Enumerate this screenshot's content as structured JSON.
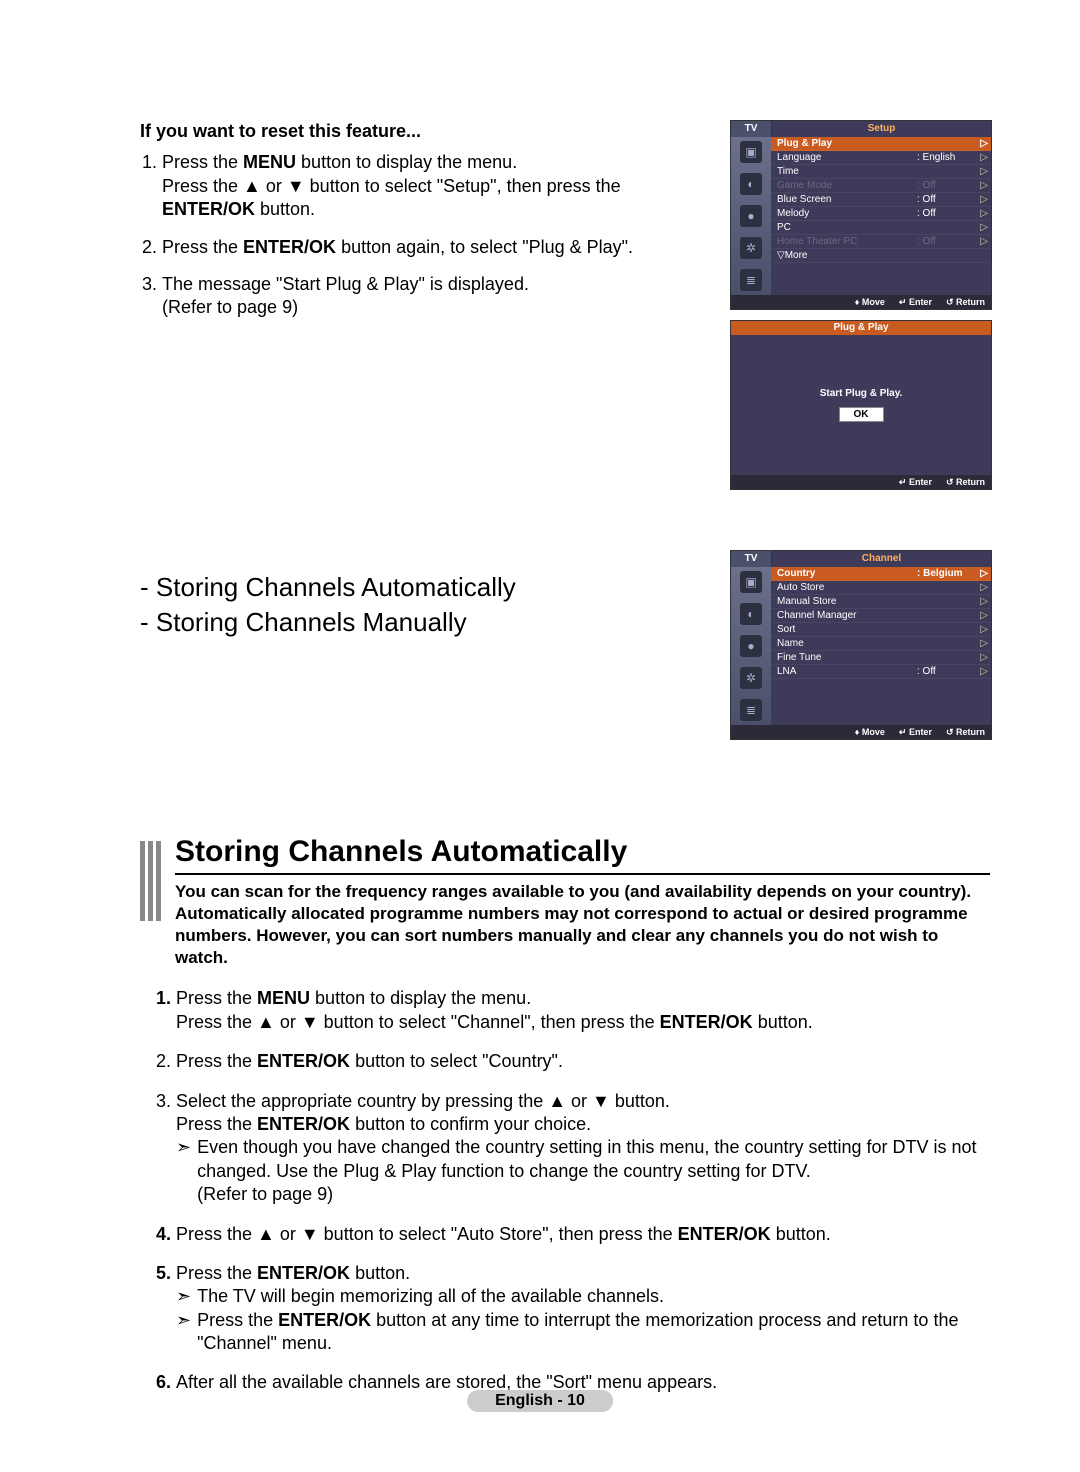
{
  "reset": {
    "heading": "If you want to reset this feature...",
    "step1a": "Press the ",
    "step1_menu": "MENU",
    "step1b": " button to display the menu.",
    "step1c": "Press the ▲ or ▼ button to select \"Setup\", then press the ",
    "step1_enter": "ENTER/OK",
    "step1d": " button.",
    "step2a": "Press the ",
    "step2_enter": "ENTER/OK",
    "step2b": " button again, to select \"Plug & Play\".",
    "step3a": "The message \"Start Plug & Play\" is displayed.",
    "step3b": "(Refer to page 9)"
  },
  "osd_setup": {
    "tv": "TV",
    "title": "Setup",
    "rows": [
      {
        "label": "Plug & Play",
        "val": "",
        "sel": true
      },
      {
        "label": "Language",
        "val": ": English"
      },
      {
        "label": "Time",
        "val": ""
      },
      {
        "label": "Game Mode",
        "val": ": Off",
        "dim": true
      },
      {
        "label": "Blue Screen",
        "val": ": Off"
      },
      {
        "label": "Melody",
        "val": ": Off"
      },
      {
        "label": "PC",
        "val": ""
      },
      {
        "label": "Home Theater PC",
        "val": ": Off",
        "dim": true
      }
    ],
    "more": "▽More",
    "foot_move": "Move",
    "foot_enter": "Enter",
    "foot_return": "Return"
  },
  "osd_plug": {
    "title": "Plug & Play",
    "msg": "Start Plug & Play.",
    "ok": "OK",
    "foot_enter": "Enter",
    "foot_return": "Return"
  },
  "mid": {
    "line1": "- Storing Channels Automatically",
    "line2": "- Storing Channels Manually"
  },
  "osd_channel": {
    "tv": "TV",
    "title": "Channel",
    "rows": [
      {
        "label": "Country",
        "val": ": Belgium",
        "sel": true
      },
      {
        "label": "Auto Store",
        "val": ""
      },
      {
        "label": "Manual Store",
        "val": ""
      },
      {
        "label": "Channel Manager",
        "val": ""
      },
      {
        "label": "Sort",
        "val": ""
      },
      {
        "label": "Name",
        "val": ""
      },
      {
        "label": "Fine Tune",
        "val": ""
      },
      {
        "label": "LNA",
        "val": ": Off"
      }
    ],
    "foot_move": "Move",
    "foot_enter": "Enter",
    "foot_return": "Return"
  },
  "sec": {
    "title": "Storing Channels Automatically",
    "intro": "You can scan for the frequency ranges available to you (and availability depends on your country). Automatically allocated programme numbers may not correspond to actual or desired programme numbers. However, you can sort numbers manually and clear any channels you do not wish to watch."
  },
  "steps": {
    "s1a": "Press the ",
    "s1_menu": "MENU",
    "s1b": " button to display the menu.",
    "s1c": "Press the ▲ or ▼ button to select \"Channel\", then press the ",
    "s1_enter": "ENTER/OK",
    "s1d": " button.",
    "s2a": "Press the ",
    "s2_enter": "ENTER/OK",
    "s2b": " button to select \"Country\".",
    "s3a": "Select the appropriate country by pressing the ▲ or ▼ button.",
    "s3b": "Press the ",
    "s3_enter": "ENTER/OK",
    "s3c": " button to confirm your choice.",
    "s3d": "Even though you have changed the country setting in this menu, the country setting for DTV is not changed. Use the Plug & Play function to change the country setting for DTV.",
    "s3e": "(Refer to page 9)",
    "s4a": "Press the ▲ or ▼ button to select \"Auto Store\", then press the ",
    "s4_enter": "ENTER/OK",
    "s4b": " button.",
    "s5a": "Press the ",
    "s5_enter": "ENTER/OK",
    "s5b": " button.",
    "s5c": "The TV will begin memorizing all of the available channels.",
    "s5d": "Press the ",
    "s5_enter2": "ENTER/OK",
    "s5e": " button at any time to interrupt the memorization process and return to the \"Channel\" menu.",
    "s6": "After all the available channels are stored, the \"Sort\" menu appears."
  },
  "footer": "English - 10"
}
